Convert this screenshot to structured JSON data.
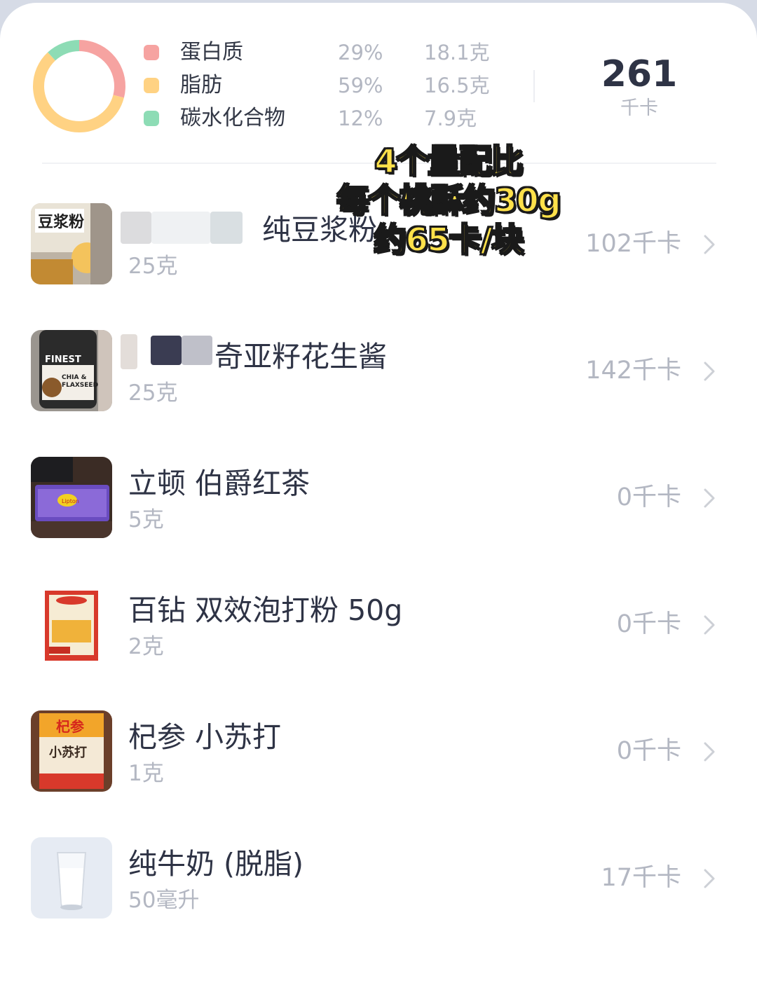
{
  "summary": {
    "macros": [
      {
        "name": "蛋白质",
        "percent": "29%",
        "grams": "18.1克",
        "color": "#f6a3a1",
        "share": 0.29
      },
      {
        "name": "脂肪",
        "percent": "59%",
        "grams": "16.5克",
        "color": "#ffd283",
        "share": 0.59
      },
      {
        "name": "碳水化合物",
        "percent": "12%",
        "grams": "7.9克",
        "color": "#8ddcb5",
        "share": 0.12
      }
    ],
    "total_value": "261",
    "total_unit": "千卡"
  },
  "overlay": {
    "lines": [
      "4个量配比",
      "每个桃酥约30g",
      "约65卡/块"
    ],
    "color": "#ffe14a"
  },
  "items": [
    {
      "name": "纯豆浆粉",
      "amount": "25克",
      "kcal": "102千卡",
      "icon": "soy-milk-powder-photo"
    },
    {
      "name": "奇亚籽花生酱",
      "amount": "25克",
      "kcal": "142千卡",
      "icon": "peanut-butter-jar-photo"
    },
    {
      "name": "立顿 伯爵红茶",
      "amount": "5克",
      "kcal": "0千卡",
      "icon": "tea-box-photo"
    },
    {
      "name": "百钻 双效泡打粉 50g",
      "amount": "2克",
      "kcal": "0千卡",
      "icon": "baking-powder-packet-photo"
    },
    {
      "name": "杞参 小苏打",
      "amount": "1克",
      "kcal": "0千卡",
      "icon": "baking-soda-packet-photo"
    },
    {
      "name": "纯牛奶 (脱脂)",
      "amount": "50毫升",
      "kcal": "17千卡",
      "icon": "milk-glass-photo"
    }
  ]
}
